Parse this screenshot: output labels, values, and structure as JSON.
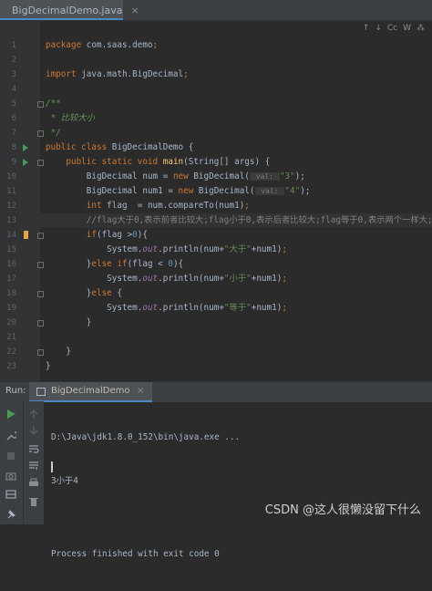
{
  "tab": {
    "filename": "BigDecimalDemo.java",
    "close": "×"
  },
  "editor_toolbar": {
    "up": "↑",
    "down": "↓",
    "case": "Cc",
    "word": "W",
    "regex": "⁂"
  },
  "lines": [
    {
      "n": "1",
      "parts": [
        {
          "t": "package ",
          "c": "kw"
        },
        {
          "t": "com.saas.demo",
          "c": ""
        },
        {
          "t": ";",
          "c": "kw"
        }
      ]
    },
    {
      "n": "2",
      "parts": []
    },
    {
      "n": "3",
      "parts": [
        {
          "t": "import ",
          "c": "kw"
        },
        {
          "t": "java.math.BigDecimal",
          "c": ""
        },
        {
          "t": ";",
          "c": "kw"
        }
      ]
    },
    {
      "n": "4",
      "parts": []
    },
    {
      "n": "5",
      "parts": [
        {
          "t": "/**",
          "c": "doc"
        }
      ]
    },
    {
      "n": "6",
      "parts": [
        {
          "t": " * 比较大小",
          "c": "doc"
        }
      ]
    },
    {
      "n": "7",
      "parts": [
        {
          "t": " */",
          "c": "doc"
        }
      ]
    },
    {
      "n": "8",
      "parts": [
        {
          "t": "public class ",
          "c": "kw"
        },
        {
          "t": "BigDecimalDemo",
          "c": ""
        },
        {
          "t": " {",
          "c": ""
        }
      ]
    },
    {
      "n": "9",
      "parts": [
        {
          "t": "    public static void ",
          "c": "kw"
        },
        {
          "t": "main",
          "c": "fn"
        },
        {
          "t": "(String[] args) {",
          "c": ""
        }
      ]
    },
    {
      "n": "10",
      "parts": [
        {
          "t": "        BigDecimal num = ",
          "c": ""
        },
        {
          "t": "new ",
          "c": "kw"
        },
        {
          "t": "BigDecimal(",
          "c": ""
        },
        {
          "t": " val: ",
          "c": "hint"
        },
        {
          "t": "\"3\"",
          "c": "str"
        },
        {
          "t": ");",
          "c": ""
        }
      ]
    },
    {
      "n": "11",
      "parts": [
        {
          "t": "        BigDecimal num1 = ",
          "c": ""
        },
        {
          "t": "new ",
          "c": "kw"
        },
        {
          "t": "BigDecimal(",
          "c": ""
        },
        {
          "t": " val: ",
          "c": "hint"
        },
        {
          "t": "\"4\"",
          "c": "str"
        },
        {
          "t": ");",
          "c": ""
        }
      ]
    },
    {
      "n": "12",
      "parts": [
        {
          "t": "        int ",
          "c": "kw"
        },
        {
          "t": "flag  = num.compareTo(num1)",
          "c": ""
        },
        {
          "t": ";",
          "c": "kw"
        }
      ]
    },
    {
      "n": "13",
      "parts": [
        {
          "t": "        //flag大于0,表示前者比较大;flag小于0,表示后者比较大;flag等于0,表示两个一样大;",
          "c": "cmt"
        }
      ]
    },
    {
      "n": "14",
      "parts": [
        {
          "t": "        if",
          "c": "kw"
        },
        {
          "t": "(flag >",
          "c": ""
        },
        {
          "t": "0",
          "c": "num"
        },
        {
          "t": "){",
          "c": ""
        }
      ]
    },
    {
      "n": "15",
      "parts": [
        {
          "t": "            System.",
          "c": ""
        },
        {
          "t": "out",
          "c": "fld"
        },
        {
          "t": ".println(num+",
          "c": ""
        },
        {
          "t": "\"大于\"",
          "c": "str"
        },
        {
          "t": "+num1)",
          "c": ""
        },
        {
          "t": ";",
          "c": "kw"
        }
      ]
    },
    {
      "n": "16",
      "parts": [
        {
          "t": "        }",
          "c": ""
        },
        {
          "t": "else if",
          "c": "kw"
        },
        {
          "t": "(flag < ",
          "c": ""
        },
        {
          "t": "0",
          "c": "num"
        },
        {
          "t": "){",
          "c": ""
        }
      ]
    },
    {
      "n": "17",
      "parts": [
        {
          "t": "            System.",
          "c": ""
        },
        {
          "t": "out",
          "c": "fld"
        },
        {
          "t": ".println(num+",
          "c": ""
        },
        {
          "t": "\"小于\"",
          "c": "str"
        },
        {
          "t": "+num1)",
          "c": ""
        },
        {
          "t": ";",
          "c": "kw"
        }
      ]
    },
    {
      "n": "18",
      "parts": [
        {
          "t": "        }",
          "c": ""
        },
        {
          "t": "else ",
          "c": "kw"
        },
        {
          "t": "{",
          "c": ""
        }
      ]
    },
    {
      "n": "19",
      "parts": [
        {
          "t": "            System.",
          "c": ""
        },
        {
          "t": "out",
          "c": "fld"
        },
        {
          "t": ".println(num+",
          "c": ""
        },
        {
          "t": "\"等于\"",
          "c": "str"
        },
        {
          "t": "+num1)",
          "c": ""
        },
        {
          "t": ";",
          "c": "kw"
        }
      ]
    },
    {
      "n": "20",
      "parts": [
        {
          "t": "        }",
          "c": ""
        }
      ]
    },
    {
      "n": "21",
      "parts": []
    },
    {
      "n": "22",
      "parts": [
        {
          "t": "    }",
          "c": ""
        }
      ]
    },
    {
      "n": "23",
      "parts": [
        {
          "t": "}",
          "c": ""
        }
      ]
    }
  ],
  "run_panel": {
    "label": "Run:",
    "tab_name": "BigDecimalDemo",
    "tab_close": "×",
    "console": [
      "D:\\Java\\jdk1.8.0_152\\bin\\java.exe ...",
      "3小于4",
      "",
      "Process finished with exit code 0"
    ]
  },
  "watermark": "CSDN @这人很懒没留下什么",
  "colors": {
    "keyword": "#cc7832",
    "string": "#6a8759",
    "comment": "#808080",
    "doc": "#629755",
    "method": "#ffc66d",
    "number": "#6897bb",
    "field": "#9876aa",
    "run_icon": "#499c54",
    "bookmark": "#e8a33e"
  }
}
